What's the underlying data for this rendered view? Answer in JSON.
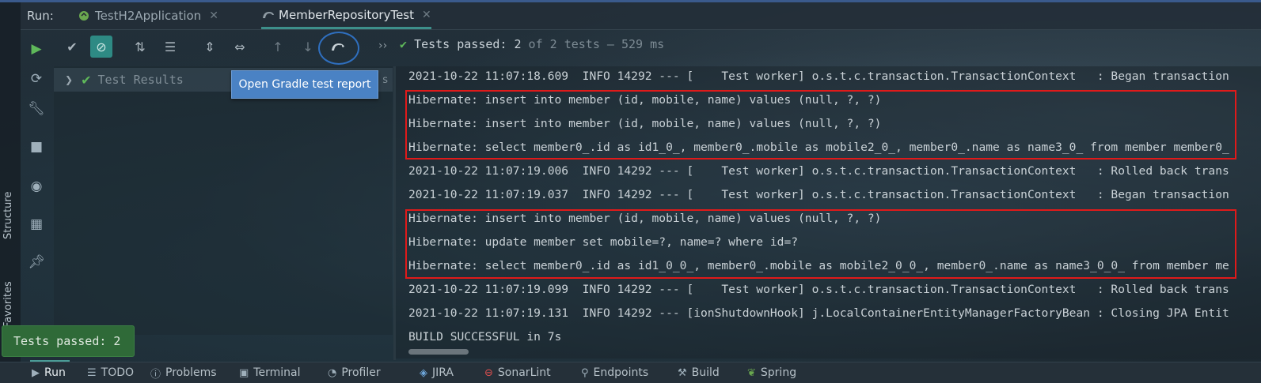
{
  "window": {
    "run_label": "Run:"
  },
  "tabs": [
    {
      "label": "TestH2Application",
      "active": false
    },
    {
      "label": "MemberRepositoryTest",
      "active": true
    }
  ],
  "side_tabs": {
    "structure": "Structure",
    "favorites": "Favorites"
  },
  "toolbar": {
    "buttons": [
      "run-icon",
      "check-icon",
      "stop-rerun-icon",
      "sort-alpha-icon",
      "sort-duration-icon",
      "expand-all-icon",
      "collapse-all-icon",
      "prev-test-icon",
      "next-test-icon",
      "gradle-report-icon"
    ],
    "status_prefix": "Tests passed: ",
    "status_count": "2",
    "status_suffix": " of 2 tests – 529 ms",
    "overflow": "››"
  },
  "tooltip": {
    "text": "Open Gradle test report"
  },
  "tree": {
    "root_label": "Test Results",
    "root_time": "s"
  },
  "console": {
    "lines": [
      "2021-10-22 11:07:18.609  INFO 14292 --- [    Test worker] o.s.t.c.transaction.TransactionContext   : Began transaction",
      "Hibernate: insert into member (id, mobile, name) values (null, ?, ?)",
      "Hibernate: insert into member (id, mobile, name) values (null, ?, ?)",
      "Hibernate: select member0_.id as id1_0_, member0_.mobile as mobile2_0_, member0_.name as name3_0_ from member member0_",
      "2021-10-22 11:07:19.006  INFO 14292 --- [    Test worker] o.s.t.c.transaction.TransactionContext   : Rolled back trans",
      "2021-10-22 11:07:19.037  INFO 14292 --- [    Test worker] o.s.t.c.transaction.TransactionContext   : Began transaction",
      "Hibernate: insert into member (id, mobile, name) values (null, ?, ?)",
      "Hibernate: update member set mobile=?, name=? where id=?",
      "Hibernate: select member0_.id as id1_0_0_, member0_.mobile as mobile2_0_0_, member0_.name as name3_0_0_ from member me",
      "2021-10-22 11:07:19.099  INFO 14292 --- [    Test worker] o.s.t.c.transaction.TransactionContext   : Rolled back trans",
      "2021-10-22 11:07:19.131  INFO 14292 --- [ionShutdownHook] j.LocalContainerEntityManagerFactoryBean : Closing JPA Entit",
      "BUILD SUCCESSFUL in 7s"
    ]
  },
  "toast": {
    "text": "Tests passed: 2"
  },
  "bottom_bar": [
    {
      "label": "Run",
      "icon": "run-icon"
    },
    {
      "label": "TODO",
      "icon": "list-icon"
    },
    {
      "label": "Problems",
      "icon": "info-icon"
    },
    {
      "label": "Terminal",
      "icon": "terminal-icon"
    },
    {
      "label": "Profiler",
      "icon": "profiler-icon"
    },
    {
      "label": "JIRA",
      "icon": "jira-icon"
    },
    {
      "label": "SonarLint",
      "icon": "sonarlint-icon"
    },
    {
      "label": "Endpoints",
      "icon": "endpoints-icon"
    },
    {
      "label": "Build",
      "icon": "hammer-icon"
    },
    {
      "label": "Spring",
      "icon": "spring-leaf-icon"
    }
  ],
  "colors": {
    "accent": "#3d8f8a",
    "pass": "#5fb85a",
    "highlight_box": "#e01a1a",
    "tooltip": "#4a82c4"
  }
}
